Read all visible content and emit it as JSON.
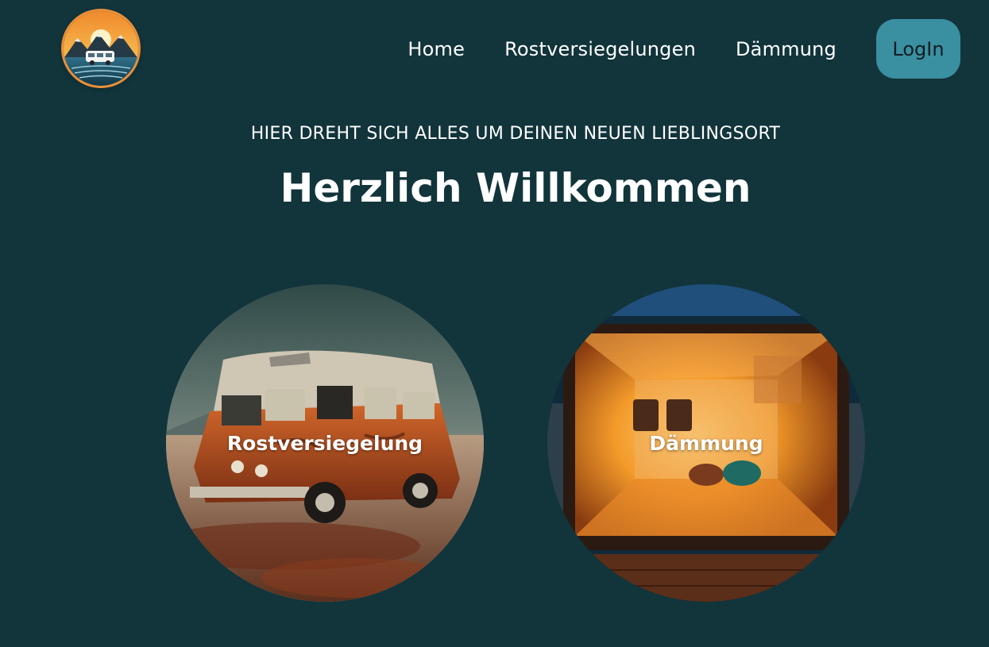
{
  "header": {
    "logo_icon": "camper-mountain-sunset-logo",
    "nav": {
      "home": "Home",
      "rostversiegelungen": "Rostversiegelungen",
      "daemmung": "Dämmung",
      "login": "LogIn"
    }
  },
  "hero": {
    "tagline": "HIER DREHT SICH ALLES UM DEINEN NEUEN LIEBLINGSORT",
    "title": "Herzlich Willkommen"
  },
  "cards": {
    "rost": {
      "label": "Rostversiegelung",
      "image": "rusty-orange-van-in-desert"
    },
    "daemm": {
      "label": "Dämmung",
      "image": "insulated-van-interior"
    }
  },
  "colors": {
    "background": "#12343b",
    "accent": "#3a8fa1",
    "logo_ring": "#e98f3a"
  }
}
